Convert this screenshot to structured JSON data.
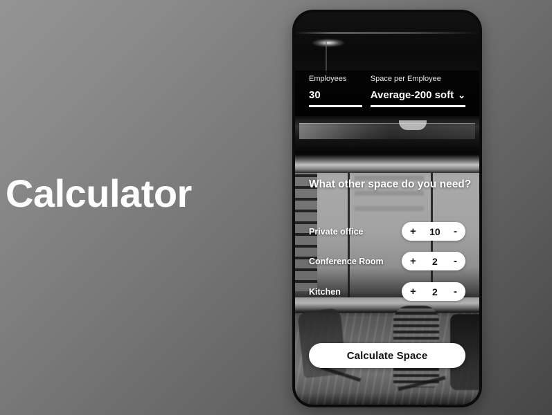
{
  "slide": {
    "title": "Calculator",
    "background_start": "#949494",
    "background_end": "#464646"
  },
  "phone": {
    "accent_white": "#ffffff",
    "screen_background": "#111111"
  },
  "form": {
    "employees": {
      "label": "Employees",
      "value": "30",
      "placeholder": "30"
    },
    "space_per_employee": {
      "label": "Space per Employee",
      "value": "Average-200 soft",
      "chevron": "⌄"
    }
  },
  "other_space": {
    "heading": "What other space do you need?",
    "options": [
      {
        "label": "Private office",
        "value": "10",
        "increment": "+",
        "decrement": "-"
      },
      {
        "label": "Conference Room",
        "value": "2",
        "increment": "+",
        "decrement": "-"
      },
      {
        "label": "Kitchen",
        "value": "2",
        "increment": "+",
        "decrement": "-"
      }
    ]
  },
  "cta": {
    "label": "Calculate Space"
  }
}
